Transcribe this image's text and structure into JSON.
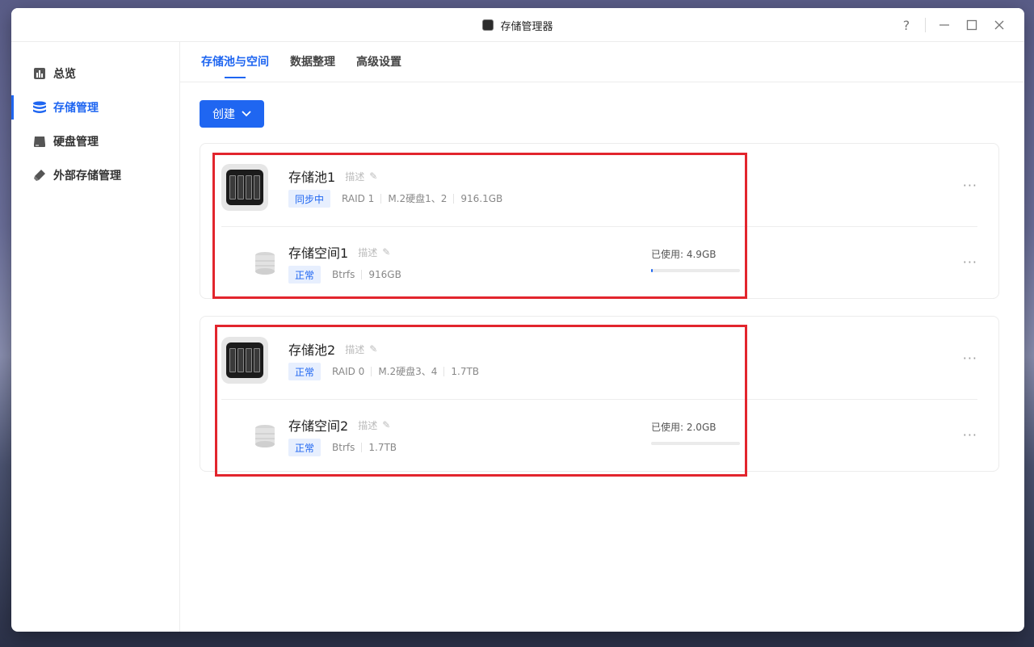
{
  "window": {
    "title": "存储管理器",
    "help_label": "?"
  },
  "sidebar": {
    "items": [
      {
        "label": "总览",
        "icon": "bar-chart-icon",
        "active": false
      },
      {
        "label": "存储管理",
        "icon": "database-icon",
        "active": true
      },
      {
        "label": "硬盘管理",
        "icon": "hard-drive-icon",
        "active": false
      },
      {
        "label": "外部存储管理",
        "icon": "usb-drive-icon",
        "active": false
      }
    ]
  },
  "tabs": [
    {
      "label": "存储池与空间",
      "active": true
    },
    {
      "label": "数据整理",
      "active": false
    },
    {
      "label": "高级设置",
      "active": false
    }
  ],
  "toolbar": {
    "create_label": "创建"
  },
  "pools": [
    {
      "name": "存储池1",
      "desc": "描述",
      "status": "同步中",
      "raid": "RAID 1",
      "disks": "M.2硬盘1、2",
      "size": "916.1GB",
      "volume": {
        "name": "存储空间1",
        "desc": "描述",
        "status": "正常",
        "fs": "Btrfs",
        "size": "916GB",
        "used_label": "已使用: 4.9GB",
        "used_fraction": 0.006
      }
    },
    {
      "name": "存储池2",
      "desc": "描述",
      "status": "正常",
      "raid": "RAID 0",
      "disks": "M.2硬盘3、4",
      "size": "1.7TB",
      "volume": {
        "name": "存储空间2",
        "desc": "描述",
        "status": "正常",
        "fs": "Btrfs",
        "size": "1.7TB",
        "used_label": "已使用: 2.0GB",
        "used_fraction": 0.0
      }
    }
  ],
  "colors": {
    "accent": "#1f66f1",
    "highlight": "#e2252d"
  }
}
